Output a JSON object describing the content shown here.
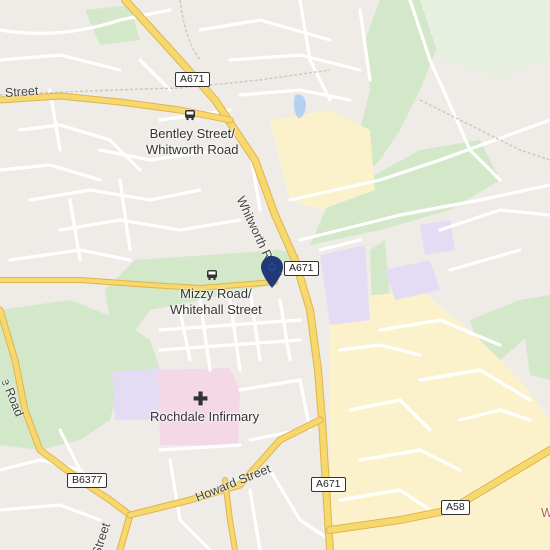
{
  "map": {
    "labels": {
      "bentley_stop": [
        "Bentley Street/",
        "Whitworth Road"
      ],
      "mizzy_stop": [
        "Mizzy Road/",
        "Whitehall Street"
      ],
      "infirmary": "Rochdale Infirmary"
    },
    "roads": {
      "whitworth": "Whitworth Road",
      "howard": "Howard Street",
      "street_top": "Street",
      "edge_left": "Falinge Road",
      "edge_bottom": "Street",
      "edge_right": "W"
    },
    "shields": {
      "a671_top": "A671",
      "a671_mid": "A671",
      "a671_bottom": "A671",
      "b6377": "B6377",
      "a58": "A58"
    },
    "icons": {
      "bus_stop": "bus-icon",
      "hospital": "hospital-cross-icon",
      "marker": "location-pin-icon"
    },
    "colors": {
      "land": "#efebe7",
      "park": "#d2e8c9",
      "major_road": "#f6d86f",
      "minor_road": "#ffffff",
      "hospital_area": "#f4d8e6",
      "school_area": "#e4dcf4",
      "commercial": "#fbf2cc",
      "water": "#b2d2f0",
      "marker": "#1f3a76"
    }
  }
}
